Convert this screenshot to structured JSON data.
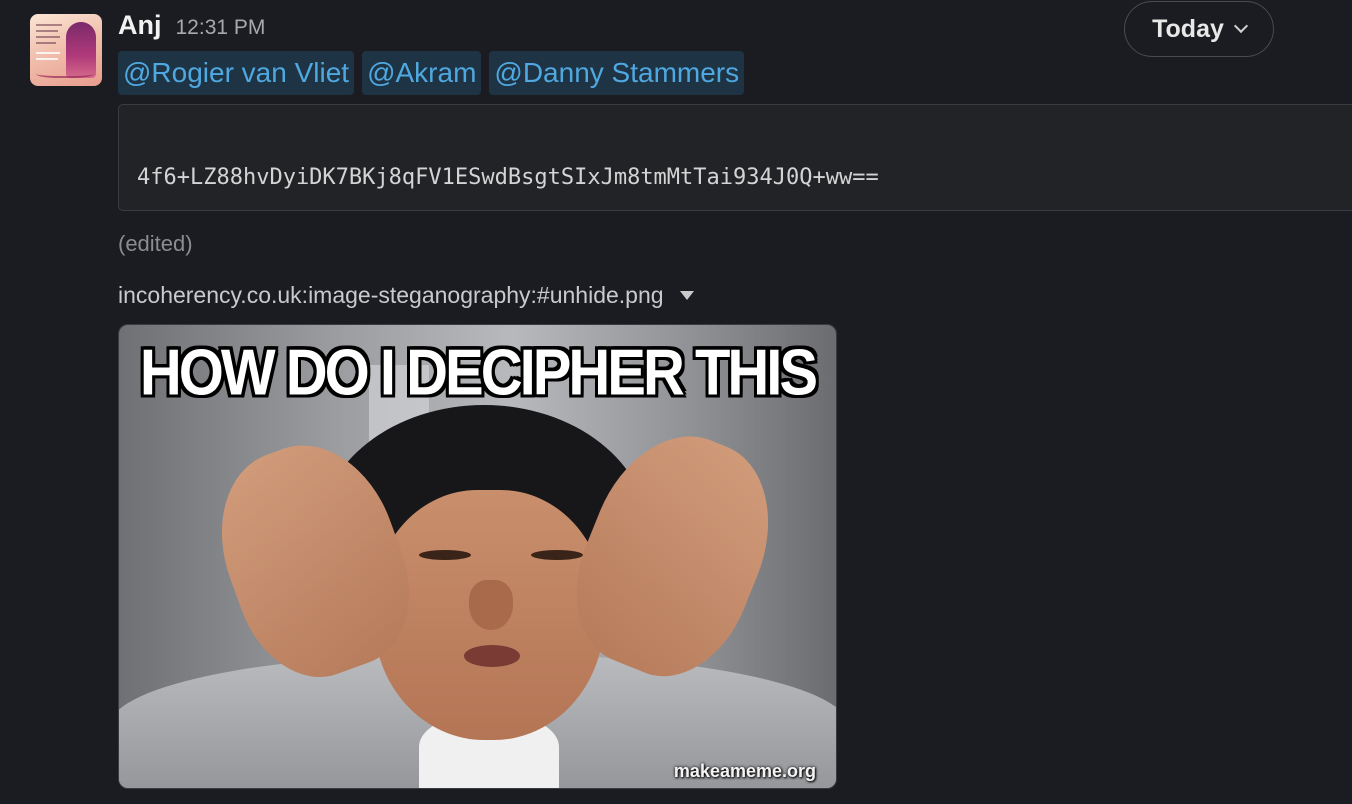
{
  "message": {
    "author": "Anj",
    "time": "12:31 PM",
    "mentions": [
      "@Rogier van Vliet",
      "@Akram",
      "@Danny Stammers"
    ],
    "code": "4f6+LZ88hvDyiDK7BKj8qFV1ESwdBsgtSIxJm8tmMtTai934J0Q+ww==",
    "edited_label": "(edited)",
    "attachment": {
      "filename": "incoherency.co.uk:image-steganography:#unhide.png",
      "meme_caption": "HOW DO I DECIPHER THIS",
      "watermark": "makeameme.org"
    }
  },
  "date_divider": {
    "label": "Today"
  },
  "colors": {
    "background": "#1b1c21",
    "mention_text": "#4fa8e0",
    "mention_bg": "#1e3344",
    "muted_text": "#8b8c8f"
  },
  "icons": {
    "date_chevron": "chevron-down-icon",
    "attachment_caret": "caret-down-icon"
  }
}
